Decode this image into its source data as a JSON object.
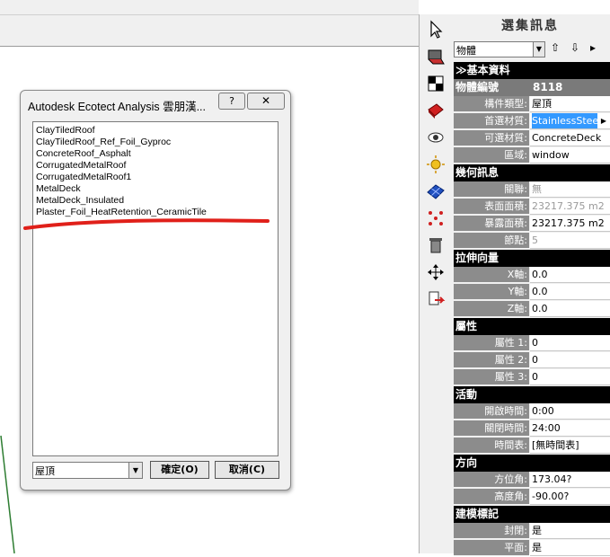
{
  "dialog": {
    "title": "Autodesk Ecotect Analysis 雲朋漢...",
    "help_label": "?",
    "close_label": "✕",
    "items": [
      "ClayTiledRoof",
      "ClayTiledRoof_Ref_Foil_Gyproc",
      "ConcreteRoof_Asphalt",
      "CorrugatedMetalRoof",
      "CorrugatedMetalRoof1",
      "MetalDeck",
      "MetalDeck_Insulated",
      "Plaster_Foil_HeatRetention_CeramicTile"
    ],
    "combo_value": "屋頂",
    "ok_label": "確定(O)",
    "cancel_label": "取消(C)"
  },
  "panel": {
    "title": "選集訊息",
    "object_select": "物體",
    "nav_up": "⇧",
    "nav_down": "⇩",
    "nav_right": "▸",
    "sections": [
      {
        "title": "≫基本資料",
        "id_key": "物體編號",
        "id_value": "8118",
        "props": [
          {
            "k": "構件類型:",
            "v": "屋頂"
          },
          {
            "k": "首選材質:",
            "v": "StainlessSteel",
            "highlight": true
          },
          {
            "k": "可選材質:",
            "v": "ConcreteDeck"
          },
          {
            "k": "區域:",
            "v": "window"
          }
        ]
      },
      {
        "title": "幾何訊息",
        "props": [
          {
            "k": "關聯:",
            "v": "無",
            "gray": true
          },
          {
            "k": "表面面積:",
            "v": "23217.375 m2",
            "gray": true
          },
          {
            "k": "暴露面積:",
            "v": "23217.375 m2"
          },
          {
            "k": "節點:",
            "v": "5",
            "gray": true
          }
        ]
      },
      {
        "title": "拉伸向量",
        "props": [
          {
            "k": "X軸:",
            "v": "0.0"
          },
          {
            "k": "Y軸:",
            "v": "0.0"
          },
          {
            "k": "Z軸:",
            "v": "0.0"
          }
        ]
      },
      {
        "title": "屬性",
        "props": [
          {
            "k": "屬性 1:",
            "v": "0"
          },
          {
            "k": "屬性 2:",
            "v": "0"
          },
          {
            "k": "屬性 3:",
            "v": "0"
          }
        ]
      },
      {
        "title": "活動",
        "props": [
          {
            "k": "開啟時間:",
            "v": "0:00"
          },
          {
            "k": "關閉時間:",
            "v": "24:00"
          },
          {
            "k": "時間表:",
            "v": "[無時間表]"
          }
        ]
      },
      {
        "title": "方向",
        "props": [
          {
            "k": "方位角:",
            "v": "173.04?"
          },
          {
            "k": "高度角:",
            "v": "-90.00?"
          }
        ]
      },
      {
        "title": "建模標記",
        "props": [
          {
            "k": "封閉:",
            "v": "是"
          },
          {
            "k": "平面:",
            "v": "是"
          }
        ]
      }
    ]
  },
  "toolbar": {
    "icons": [
      "pointer-icon",
      "surface-icon",
      "checker-icon",
      "material-icon",
      "eye-icon",
      "sun-icon",
      "grid-icon",
      "nodes-icon",
      "trash-icon",
      "move-icon",
      "export-icon"
    ]
  },
  "colors": {
    "section_bg": "#000000",
    "label_bg": "#8c8c8c",
    "highlight": "#3399ff",
    "annotation": "#e0201a"
  }
}
